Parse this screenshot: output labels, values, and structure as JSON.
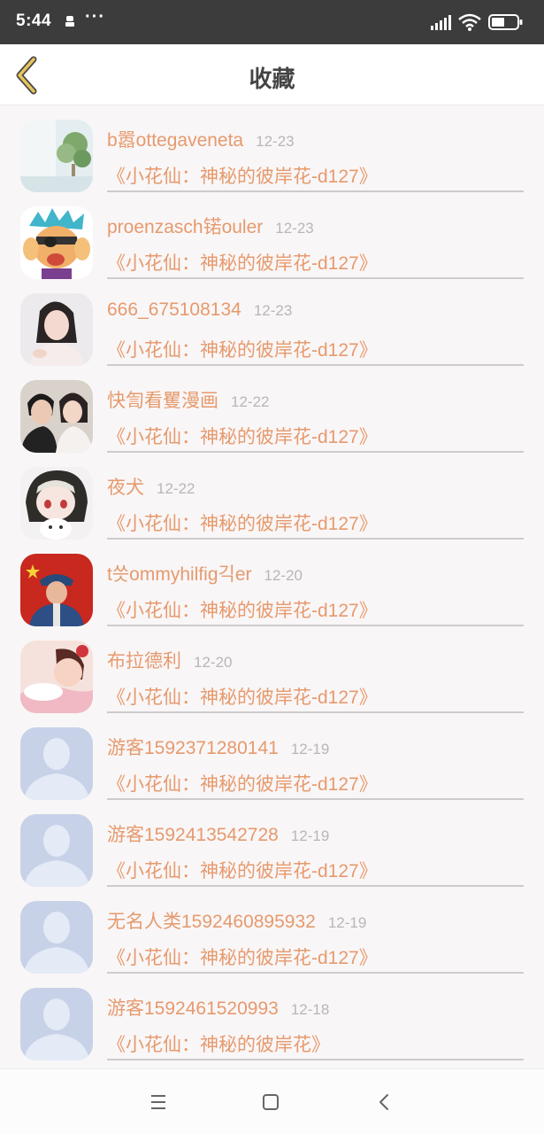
{
  "status_bar": {
    "time": "5:44",
    "dots": "···"
  },
  "header": {
    "title": "收藏"
  },
  "items": [
    {
      "name": "b嚣ottegaveneta",
      "date": "12-23",
      "title": "《小花仙：神秘的彼岸花-d127》",
      "avatar": "plant-photo"
    },
    {
      "name": "proenzasch锘ouler",
      "date": "12-23",
      "title": "《小花仙：神秘的彼岸花-d127》",
      "avatar": "cartoon-pirate"
    },
    {
      "name": "666_675108134",
      "date": "12-23",
      "title": "《小花仙：神秘的彼岸花-d127》",
      "avatar": "girl-photo"
    },
    {
      "name": "快訇看矍漫画",
      "date": "12-22",
      "title": "《小花仙：神秘的彼岸花-d127》",
      "avatar": "couple-photo"
    },
    {
      "name": "夜犬",
      "date": "12-22",
      "title": "《小花仙：神秘的彼岸花-d127》",
      "avatar": "anime-girl"
    },
    {
      "name": "t씃ommyhilfig긱er",
      "date": "12-20",
      "title": "《小花仙：神秘的彼岸花-d127》",
      "avatar": "soldier-photo"
    },
    {
      "name": "布拉德利",
      "date": "12-20",
      "title": "《小花仙：神秘的彼岸花-d127》",
      "avatar": "cartoon-sleeper"
    },
    {
      "name": "游客1592371280141",
      "date": "12-19",
      "title": "《小花仙：神秘的彼岸花-d127》",
      "avatar": "default"
    },
    {
      "name": "游客1592413542728",
      "date": "12-19",
      "title": "《小花仙：神秘的彼岸花-d127》",
      "avatar": "default"
    },
    {
      "name": "无名人类1592460895932",
      "date": "12-19",
      "title": "《小花仙：神秘的彼岸花-d127》",
      "avatar": "default"
    },
    {
      "name": "游客1592461520993",
      "date": "12-18",
      "title": "《小花仙：神秘的彼岸花》",
      "avatar": "default"
    }
  ],
  "colors": {
    "accent": "#e69a6d",
    "date": "#b7b7b7",
    "back_arrow": "#e6c659"
  },
  "icons": {
    "back": "chevron-left-icon",
    "menu": "menu-icon",
    "home": "home-square-icon",
    "nav_back": "nav-back-icon"
  }
}
